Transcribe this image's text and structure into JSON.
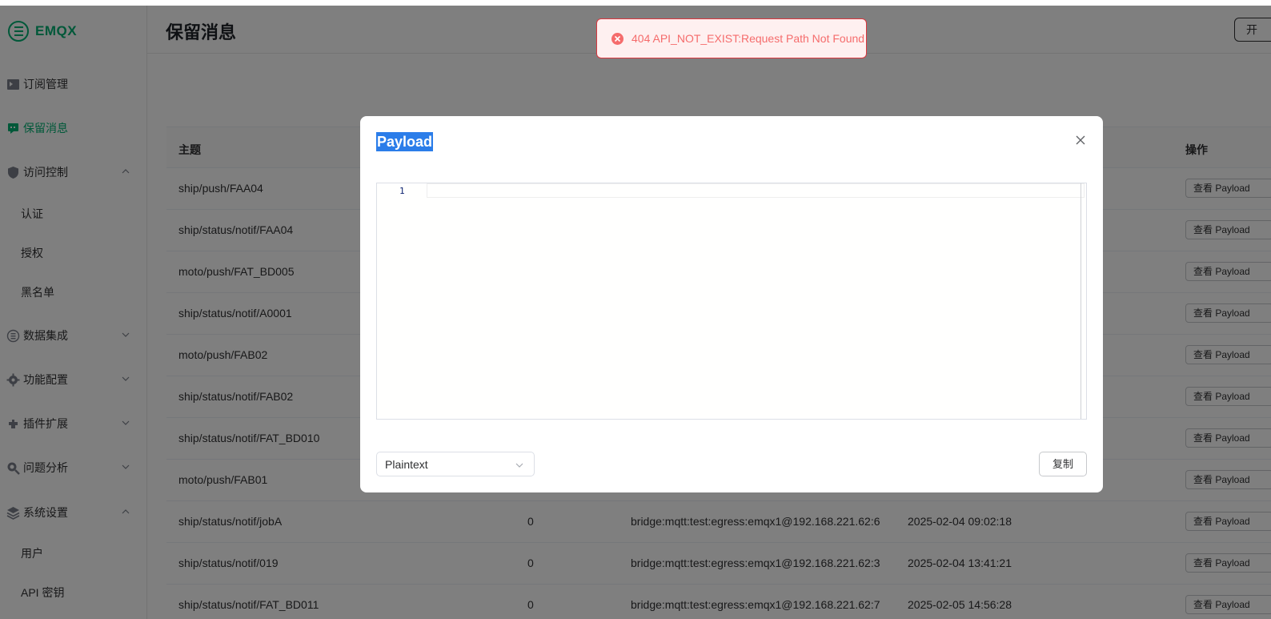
{
  "app": {
    "brand": "EMQX",
    "accent": "#00b173"
  },
  "header": {
    "title": "保留消息",
    "right_button": "开"
  },
  "sidebar": {
    "items": [
      {
        "label": "订阅管理",
        "icon": "subscription-icon"
      },
      {
        "label": "保留消息",
        "icon": "retained-message-icon",
        "active": true
      },
      {
        "label": "访问控制",
        "icon": "shield-icon",
        "expanded": true
      },
      {
        "label": "认证"
      },
      {
        "label": "授权"
      },
      {
        "label": "黑名单"
      },
      {
        "label": "数据集成",
        "icon": "data-integration-icon"
      },
      {
        "label": "功能配置",
        "icon": "gear-icon"
      },
      {
        "label": "插件扩展",
        "icon": "plugin-icon"
      },
      {
        "label": "问题分析",
        "icon": "diagnose-icon"
      },
      {
        "label": "系统设置",
        "icon": "settings-icon",
        "expanded": true
      },
      {
        "label": "用户"
      },
      {
        "label": "API 密钥"
      }
    ]
  },
  "table": {
    "columns": [
      "主题",
      "操作"
    ],
    "row_action_label": "查看 Payload",
    "rows": [
      {
        "topic": "ship/push/FAA04"
      },
      {
        "topic": "ship/status/notif/FAA04"
      },
      {
        "topic": "moto/push/FAT_BD005"
      },
      {
        "topic": "ship/status/notif/A0001"
      },
      {
        "topic": "moto/push/FAB02"
      },
      {
        "topic": "ship/status/notif/FAB02"
      },
      {
        "topic": "ship/status/notif/FAT_BD010"
      },
      {
        "topic": "moto/push/FAB01"
      },
      {
        "topic": "ship/status/notif/jobA",
        "qos": "0",
        "from": "bridge:mqtt:test:egress:emqx1@192.168.221.62:6",
        "time": "2025-02-04 09:02:18"
      },
      {
        "topic": "ship/status/notif/019",
        "qos": "0",
        "from": "bridge:mqtt:test:egress:emqx1@192.168.221.62:3",
        "time": "2025-02-04 13:41:21"
      },
      {
        "topic": "ship/status/notif/FAT_BD011",
        "qos": "0",
        "from": "bridge:mqtt:test:egress:emqx1@192.168.221.62:7",
        "time": "2025-02-05 14:56:28"
      }
    ]
  },
  "dialog": {
    "title": "Payload",
    "editor": {
      "line_number": "1",
      "content": ""
    },
    "format_select": "Plaintext",
    "copy_button": "复制"
  },
  "toast": {
    "message": "404 API_NOT_EXIST:Request Path Not Found",
    "type": "error",
    "color": "#f56c6c"
  }
}
